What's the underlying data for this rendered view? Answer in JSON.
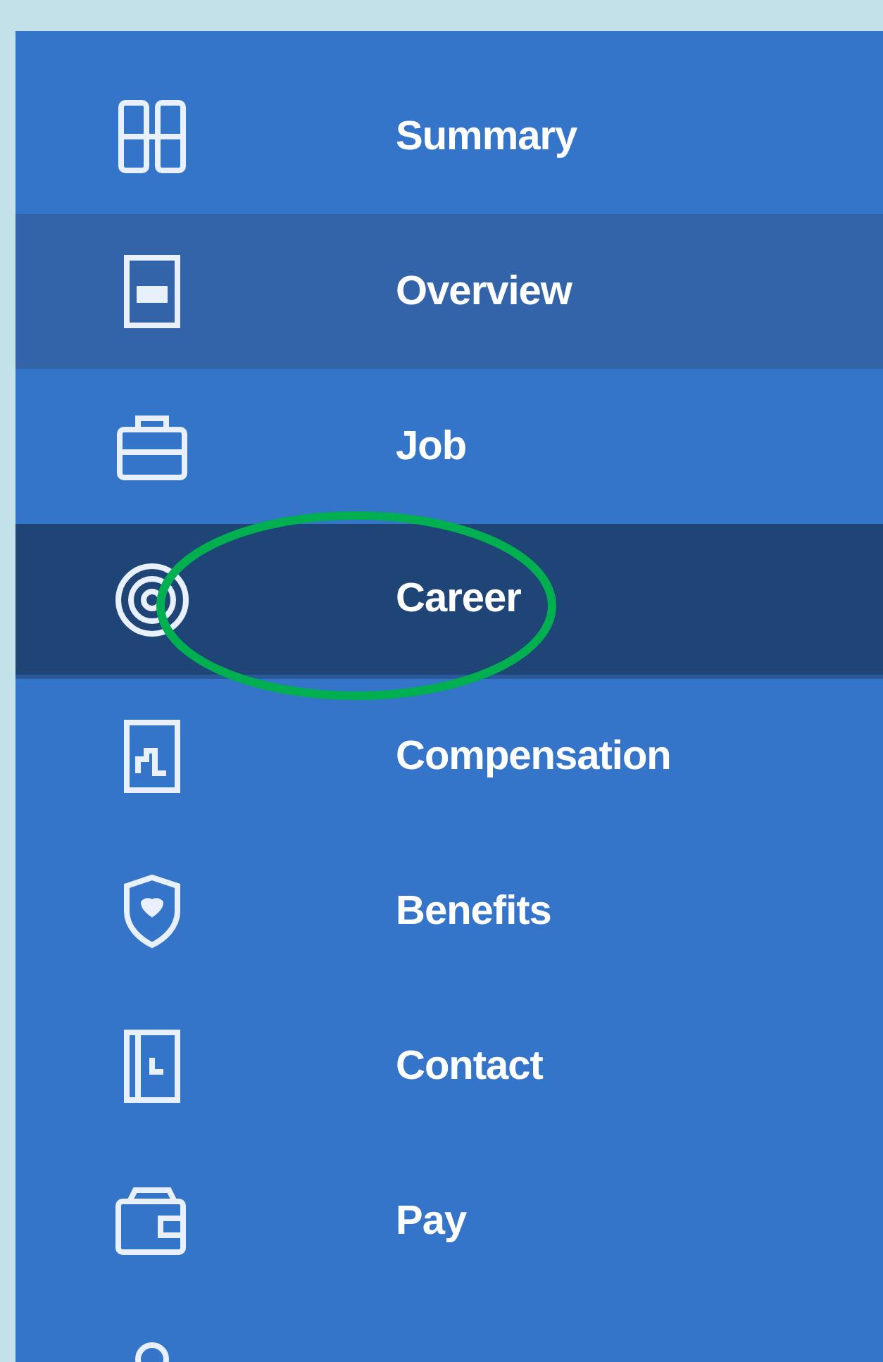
{
  "sidebar": {
    "items": [
      {
        "label": "Summary",
        "selected": false,
        "highlighted": false
      },
      {
        "label": "Overview",
        "selected": false,
        "highlighted": true
      },
      {
        "label": "Job",
        "selected": false,
        "highlighted": false
      },
      {
        "label": "Career",
        "selected": true,
        "highlighted": false
      },
      {
        "label": "Compensation",
        "selected": false,
        "highlighted": false
      },
      {
        "label": "Benefits",
        "selected": false,
        "highlighted": false
      },
      {
        "label": "Contact",
        "selected": false,
        "highlighted": false
      },
      {
        "label": "Pay",
        "selected": false,
        "highlighted": false
      },
      {
        "selected": false,
        "highlighted": false
      }
    ]
  }
}
